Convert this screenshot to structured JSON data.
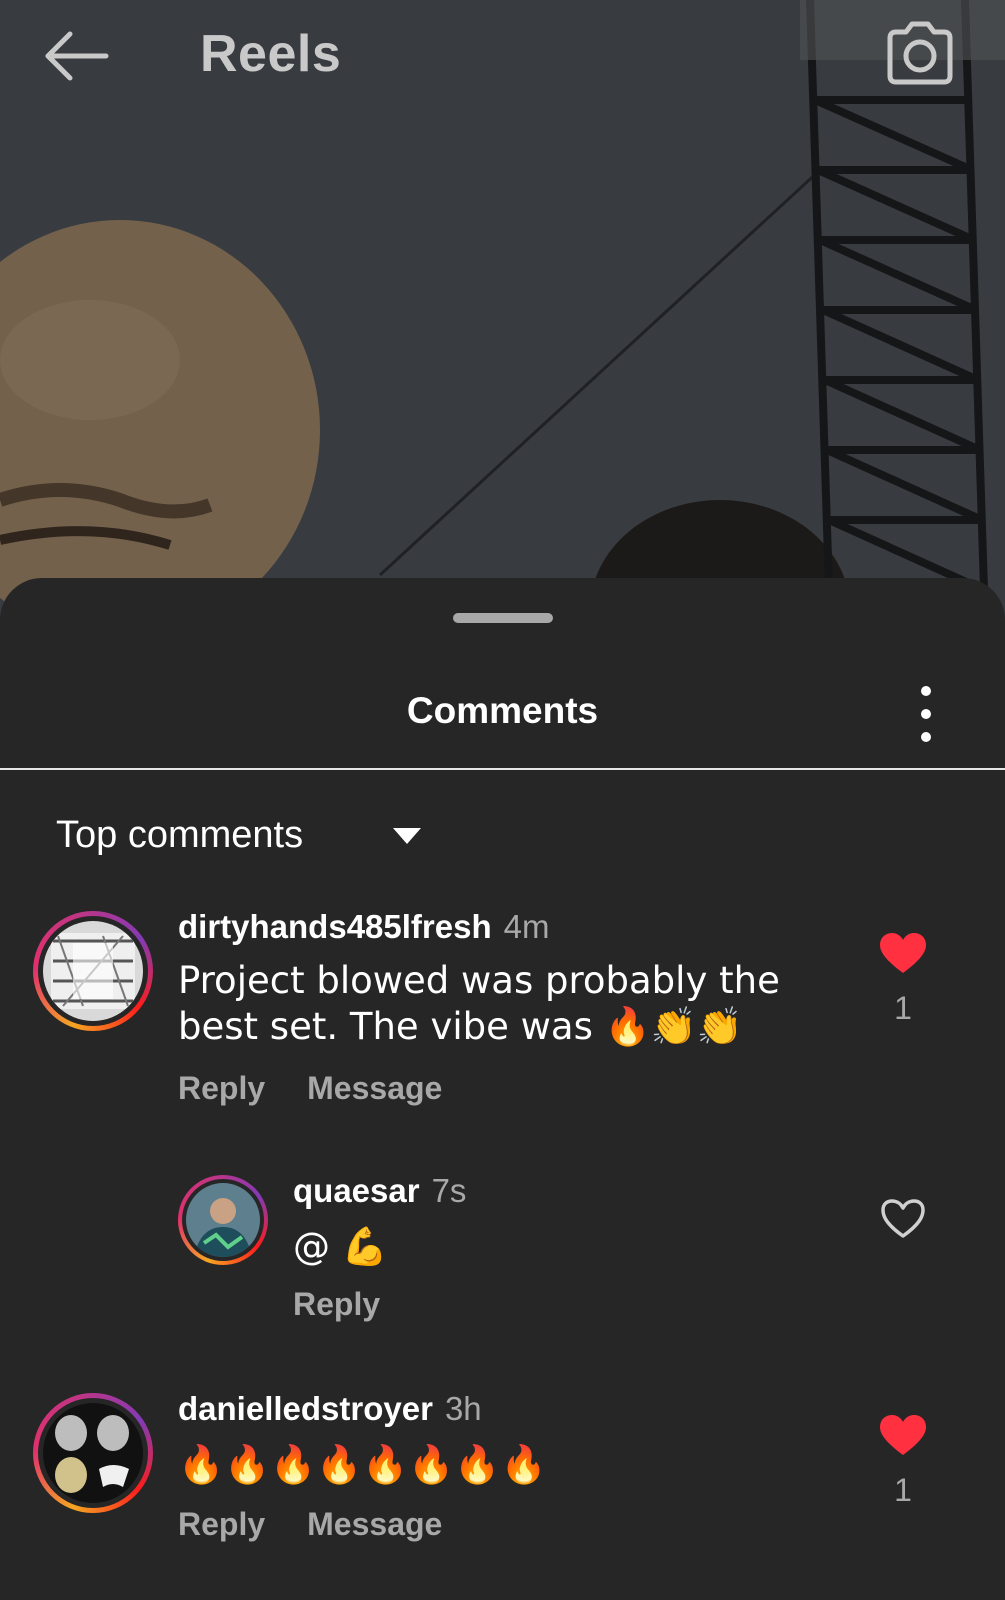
{
  "header": {
    "title": "Reels"
  },
  "sheet": {
    "title": "Comments",
    "sort_label": "Top comments"
  },
  "comments": [
    {
      "username": "dirtyhands485lfresh",
      "time": "4m",
      "text": "Project blowed was probably the best set. The vibe was 🔥👏👏",
      "actions": [
        "Reply",
        "Message"
      ],
      "likes": "1",
      "liked": true
    },
    {
      "username": "quaesar",
      "time": "7s",
      "text": "@ 💪",
      "actions": [
        "Reply"
      ],
      "likes": "",
      "liked": false,
      "is_reply": true
    },
    {
      "username": "danielledstroyer",
      "time": "3h",
      "text": "🔥🔥🔥🔥🔥🔥🔥🔥",
      "actions": [
        "Reply",
        "Message"
      ],
      "likes": "1",
      "liked": true
    }
  ],
  "colors": {
    "sheet_bg": "#262626",
    "secondary_text": "#a8a8a8",
    "like_red": "#ff3040",
    "divider": "#e6e6e6"
  },
  "icons": {
    "back": "arrow-left-icon",
    "camera": "camera-icon",
    "more": "more-vertical-icon",
    "sort": "caret-down-icon",
    "like": "heart-icon"
  }
}
